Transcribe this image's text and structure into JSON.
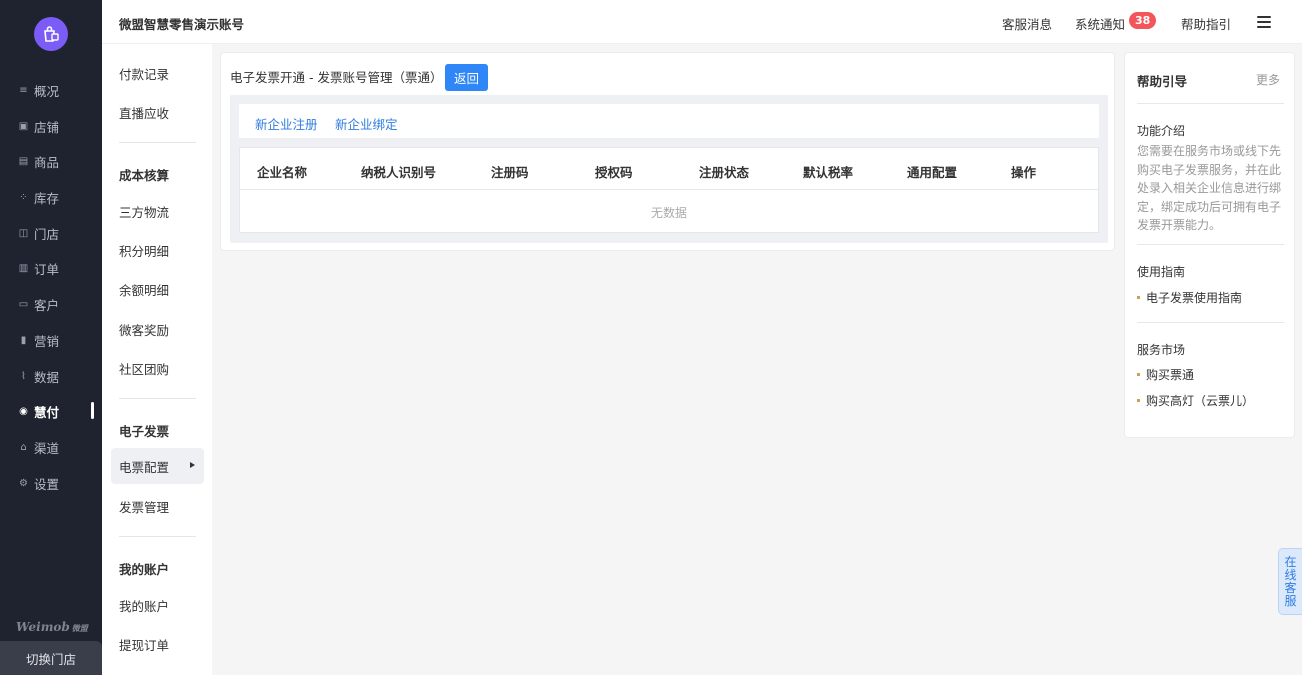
{
  "nav": {
    "items": [
      {
        "label": "概况",
        "icon": "overview-icon"
      },
      {
        "label": "店铺",
        "icon": "shop-icon"
      },
      {
        "label": "商品",
        "icon": "goods-icon"
      },
      {
        "label": "库存",
        "icon": "stock-icon"
      },
      {
        "label": "门店",
        "icon": "store-icon"
      },
      {
        "label": "订单",
        "icon": "order-icon"
      },
      {
        "label": "客户",
        "icon": "customer-icon"
      },
      {
        "label": "营销",
        "icon": "marketing-icon"
      },
      {
        "label": "数据",
        "icon": "data-icon"
      },
      {
        "label": "慧付",
        "icon": "pay-icon"
      },
      {
        "label": "渠道",
        "icon": "channel-icon"
      },
      {
        "label": "设置",
        "icon": "settings-icon"
      }
    ],
    "active": "慧付",
    "brand": "Weimob",
    "brand_cn": "微盟",
    "switch_store": "切换门店"
  },
  "header": {
    "account": "微盟智慧零售演示账号",
    "service_msg": "客服消息",
    "system_notice": "系统通知",
    "notice_count": "38",
    "help_guide": "帮助指引"
  },
  "subnav": {
    "top_items": [
      "付款记录",
      "直播应收"
    ],
    "sections": [
      {
        "title": "成本核算",
        "items": [
          "三方物流",
          "积分明细",
          "余额明细",
          "微客奖励",
          "社区团购"
        ]
      },
      {
        "title": "电子发票",
        "items": [
          "电票配置",
          "发票管理"
        ]
      },
      {
        "title": "我的账户",
        "items": [
          "我的账户",
          "提现订单"
        ]
      }
    ],
    "selected": "电票配置"
  },
  "main": {
    "breadcrumb": "电子发票开通 - 发票账号管理（票通）",
    "back_label": "返回",
    "tabs": [
      "新企业注册",
      "新企业绑定"
    ],
    "columns": [
      "企业名称",
      "纳税人识别号",
      "注册码",
      "授权码",
      "注册状态",
      "默认税率",
      "通用配置",
      "操作"
    ],
    "empty_text": "无数据"
  },
  "help": {
    "title": "帮助引导",
    "more": "更多",
    "intro_title": "功能介绍",
    "intro_text": "您需要在服务市场或线下先购买电子发票服务，并在此处录入相关企业信息进行绑定，绑定成功后可拥有电子发票开票能力。",
    "guide_title": "使用指南",
    "guide_link": "电子发票使用指南",
    "market_title": "服务市场",
    "market_links": [
      "购买票通",
      "购买高灯（云票儿）"
    ]
  },
  "float_service": [
    "在",
    "线",
    "客",
    "服"
  ],
  "colors": {
    "primary": "#2f86f6",
    "nav_bg": "#1f2330",
    "badge": "#f2555a",
    "logo": "#7c5cf6"
  }
}
